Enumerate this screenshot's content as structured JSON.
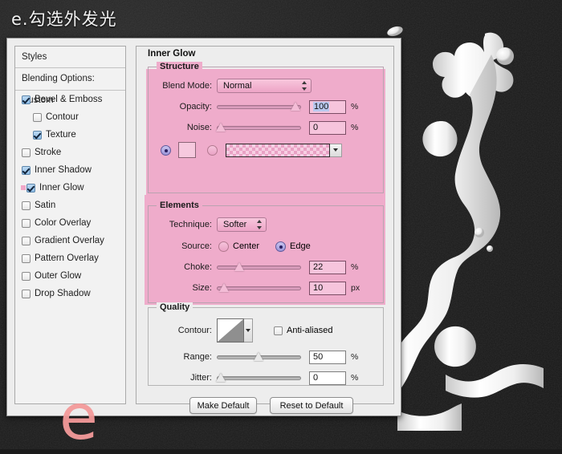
{
  "title": "e.勾选外发光",
  "watermark": "e",
  "colors": {
    "pink_highlight": "#efaccb",
    "sidebar_select": "#f0a7c8",
    "watermark": "#f49a9a"
  },
  "sidebar": {
    "header": "Styles",
    "blending": "Blending Options: Custom",
    "items": [
      {
        "label": "Bevel & Emboss",
        "checked": true,
        "indent": false,
        "selected": false
      },
      {
        "label": "Contour",
        "checked": false,
        "indent": true,
        "selected": false
      },
      {
        "label": "Texture",
        "checked": true,
        "indent": true,
        "selected": false
      },
      {
        "label": "Stroke",
        "checked": false,
        "indent": false,
        "selected": false
      },
      {
        "label": "Inner Shadow",
        "checked": true,
        "indent": false,
        "selected": false
      },
      {
        "label": "Inner Glow",
        "checked": true,
        "indent": false,
        "selected": true
      },
      {
        "label": "Satin",
        "checked": false,
        "indent": false,
        "selected": false
      },
      {
        "label": "Color Overlay",
        "checked": false,
        "indent": false,
        "selected": false
      },
      {
        "label": "Gradient Overlay",
        "checked": false,
        "indent": false,
        "selected": false
      },
      {
        "label": "Pattern Overlay",
        "checked": false,
        "indent": false,
        "selected": false
      },
      {
        "label": "Outer Glow",
        "checked": false,
        "indent": false,
        "selected": false
      },
      {
        "label": "Drop Shadow",
        "checked": false,
        "indent": false,
        "selected": false
      }
    ]
  },
  "panel": {
    "title": "Inner Glow",
    "structure": {
      "legend": "Structure",
      "blend_mode_label": "Blend Mode:",
      "blend_mode_value": "Normal",
      "opacity_label": "Opacity:",
      "opacity_value": "100",
      "opacity_unit": "%",
      "noise_label": "Noise:",
      "noise_value": "0",
      "noise_unit": "%",
      "fill_color_selected": true,
      "fill_gradient_selected": false
    },
    "elements": {
      "legend": "Elements",
      "technique_label": "Technique:",
      "technique_value": "Softer",
      "source_label": "Source:",
      "source_center": "Center",
      "source_edge": "Edge",
      "source_selected": "Edge",
      "choke_label": "Choke:",
      "choke_value": "22",
      "choke_unit": "%",
      "size_label": "Size:",
      "size_value": "10",
      "size_unit": "px"
    },
    "quality": {
      "legend": "Quality",
      "contour_label": "Contour:",
      "antialiased_label": "Anti-aliased",
      "antialiased_checked": false,
      "range_label": "Range:",
      "range_value": "50",
      "range_unit": "%",
      "jitter_label": "Jitter:",
      "jitter_value": "0",
      "jitter_unit": "%"
    },
    "buttons": {
      "make_default": "Make Default",
      "reset_to_default": "Reset to Default"
    }
  }
}
